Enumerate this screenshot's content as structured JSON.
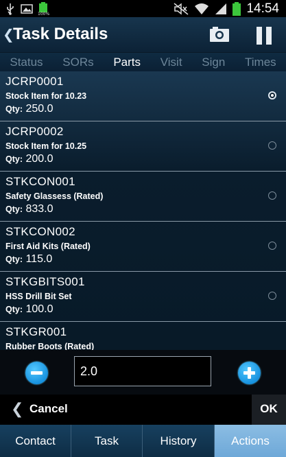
{
  "status_bar": {
    "time": "14:54",
    "battery_label": "100%",
    "left_icons": [
      "usb-icon",
      "image-icon",
      "battery-full-icon"
    ],
    "right_icons": [
      "mute-icon",
      "wifi-icon",
      "signal-icon",
      "battery-icon"
    ]
  },
  "header": {
    "title": "Task Details"
  },
  "tabs": [
    {
      "label": "Status",
      "active": false
    },
    {
      "label": "SORs",
      "active": false
    },
    {
      "label": "Parts",
      "active": true
    },
    {
      "label": "Visit",
      "active": false
    },
    {
      "label": "Sign",
      "active": false
    },
    {
      "label": "Times",
      "active": false
    }
  ],
  "parts": {
    "qty_label": "Qty:",
    "items": [
      {
        "code": "JCRP0001",
        "description": "Stock Item for 10.23",
        "qty": "250.0",
        "selected": true
      },
      {
        "code": "JCRP0002",
        "description": "Stock Item for 10.25",
        "qty": "200.0",
        "selected": false
      },
      {
        "code": "STKCON001",
        "description": "Safety Glassess (Rated)",
        "qty": "833.0",
        "selected": false
      },
      {
        "code": "STKCON002",
        "description": "First Aid Kits (Rated)",
        "qty": "115.0",
        "selected": false
      },
      {
        "code": "STKGBITS001",
        "description": "HSS Drill Bit Set",
        "qty": "100.0",
        "selected": false
      },
      {
        "code": "STKGR001",
        "description": "Rubber Boots (Rated)",
        "qty": "",
        "selected": false
      }
    ]
  },
  "quantity": {
    "value": "2.0"
  },
  "footer": {
    "cancel_label": "Cancel",
    "ok_label": "OK"
  },
  "bottom_nav": [
    {
      "label": "Contact",
      "active": false
    },
    {
      "label": "Task",
      "active": false
    },
    {
      "label": "History",
      "active": false
    },
    {
      "label": "Actions",
      "active": true
    }
  ],
  "colors": {
    "accent": "#1792df",
    "active_nav": "#7db3de",
    "header_bg": "#17354d"
  }
}
